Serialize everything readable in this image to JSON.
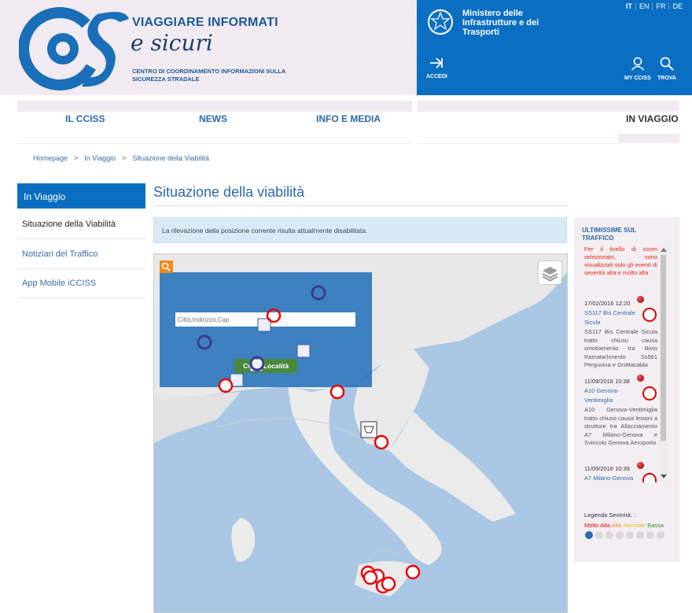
{
  "header": {
    "brand_line1": "VIAGGIARE INFORMATI",
    "brand_line2": "e sicuri",
    "brand_sub": "CENTRO DI COORDINAMENTO INFORMAZIONI SULLA SICUREZZA STRADALE",
    "ministry": "Ministero delle Infrastrutture e dei Trasporti",
    "languages": [
      "IT",
      "EN",
      "FR",
      "DE"
    ],
    "tools": {
      "login": "ACCEDI",
      "my": "MY CCISS",
      "search": "TROVA"
    }
  },
  "nav": {
    "items": [
      "IL CCISS",
      "NEWS",
      "INFO E MEDIA",
      "IN VIAGGIO"
    ]
  },
  "breadcrumb": {
    "home": "Homepage",
    "section": "In Viaggio",
    "current": "Situazione della Viabilità",
    "sep": ">"
  },
  "sidebar": {
    "heading": "In Viaggio",
    "items": [
      "Situazione della Viabilità",
      "Notiziari del Traffico",
      "App Mobile iCCISS"
    ]
  },
  "main": {
    "title": "Situazione della viabilità",
    "alert": "La rilevazione della posizione corrente risulta attualmente disabilitata.",
    "search_placeholder": "Città,Indirizzo,Cap",
    "search_button": "Cerca Località"
  },
  "news": {
    "title": "ULTIMISSIME SUL TRAFFICO",
    "notice": "Per il livello di zoom selezionato, sono visualizzati solo gli eventi di severità alta e molto alta",
    "items": [
      {
        "date": "17/02/2016 12:20",
        "road": "SS117 Bis Centrale Sicula",
        "desc": "SS117 Bis Centrale Sicula tratto chiuso causa smottamento tra Bivio Ramata/Innesto Ss561 Pergusina e Grottacalda"
      },
      {
        "date": "11/09/2018 10:38",
        "road": "A10 Genova-Ventimiglia",
        "desc": "A10 Genova-Ventimiglia tratto chiuso causa lesioni a strutture tra Allacciamento A7 Milano-Genova e Svincolo Genova Aeroporto"
      },
      {
        "date": "11/09/2018 10:39",
        "road": "A7 Milano-Genova",
        "desc": ""
      }
    ],
    "legend_label": "Legenda Severità: :",
    "severity": {
      "very_high": "Molto Alta",
      "high": "Alta",
      "normal": "Normale",
      "low": "Bassa"
    }
  },
  "colors": {
    "primary": "#0a6fc2",
    "accent": "#2b6aa8",
    "severe": "#d00000"
  }
}
